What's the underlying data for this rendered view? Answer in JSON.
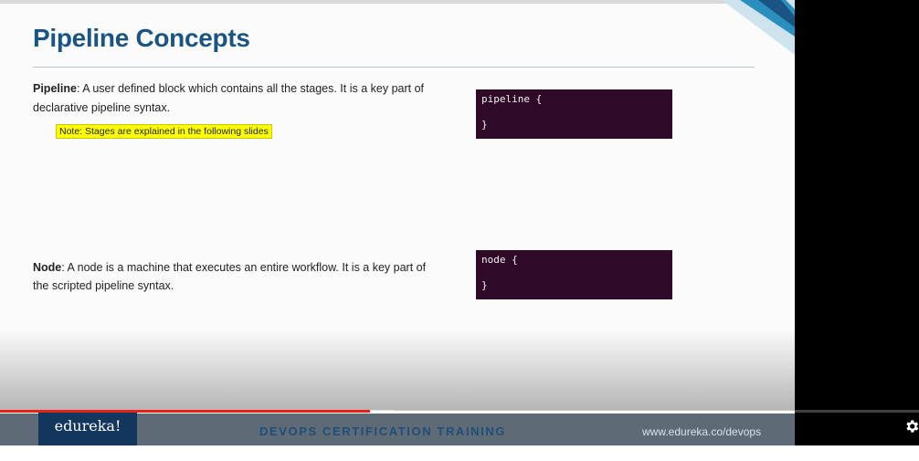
{
  "slide": {
    "title": "Pipeline Concepts",
    "pipeline": {
      "term": "Pipeline",
      "text": ": A user defined block which contains all the stages. It is a key part of declarative pipeline syntax.",
      "note": "Note: Stages are explained in the following slides",
      "code_open": "pipeline {",
      "code_close": "}"
    },
    "node": {
      "term": "Node",
      "text": ": A node is a machine that executes an entire workflow. It is a key part of the scripted pipeline syntax.",
      "code_open": "node {",
      "code_close": "}"
    },
    "footer": {
      "brand": "edureka!",
      "course": "DEVOPS CERTIFICATION TRAINING",
      "url": "www.edureka.co/devops"
    }
  },
  "player": {
    "progress_played": 0.403,
    "progress_buffered": 0.428,
    "settings_icon": "gear-icon",
    "progress_color": "#e62117"
  },
  "colors": {
    "title": "#1a5482",
    "code_bg": "#2f0a28",
    "note_bg": "#ffff00",
    "footer_bg": "#5e6a75",
    "logo_bg": "#12365c"
  }
}
